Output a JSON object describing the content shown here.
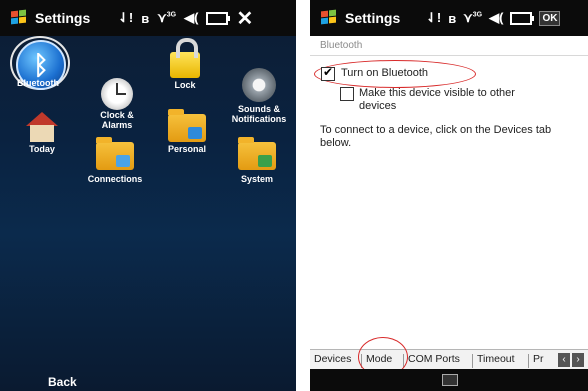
{
  "left_screen": {
    "title": "Settings",
    "status_icons": [
      "signal-icon",
      "bluetooth-status-icon",
      "network-3g-icon",
      "volume-icon",
      "battery-icon"
    ],
    "status_text": {
      "network": "3G"
    },
    "close_label": "✕",
    "tiles": {
      "bluetooth": "Bluetooth",
      "clock": "Clock &\nAlarms",
      "lock": "Lock",
      "sounds": "Sounds &\nNotifications",
      "today": "Today",
      "personal": "Personal",
      "connections": "Connections",
      "system": "System"
    },
    "back_label": "Back"
  },
  "right_screen": {
    "title": "Settings",
    "status_text": {
      "network": "3G"
    },
    "ok_label": "OK",
    "header": "Bluetooth",
    "options": {
      "turn_on": "Turn on Bluetooth",
      "visible": "Make this device visible to other devices"
    },
    "turn_on_checked": true,
    "visible_checked": false,
    "info_text": "To connect to a device, click on the Devices tab below.",
    "tabs": [
      "Devices",
      "Mode",
      "COM Ports",
      "Timeout",
      "Pr"
    ],
    "active_tab": "Mode"
  },
  "colors": {
    "highlight_oval": "#d82a2a",
    "left_bg": "#0a2240",
    "title_bar": "#0b0b0b"
  }
}
